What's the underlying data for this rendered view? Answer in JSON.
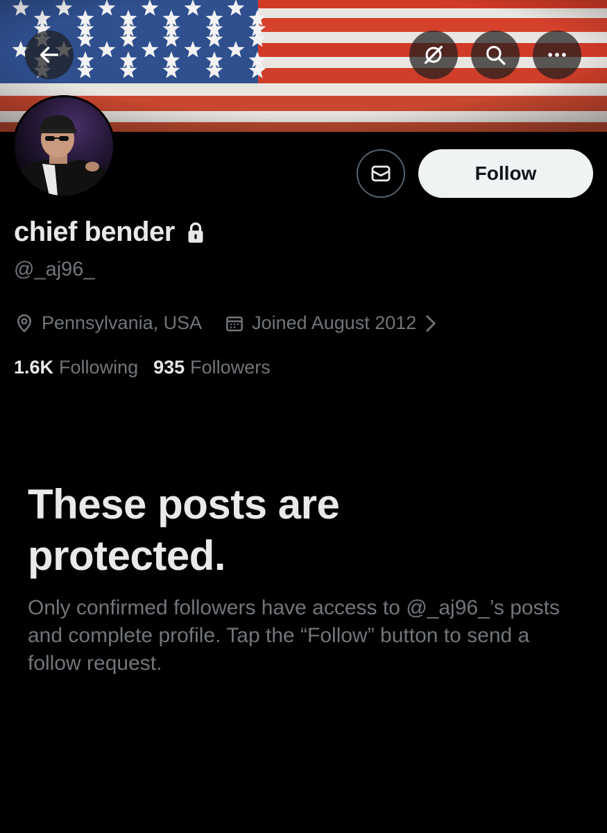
{
  "header": {
    "back_icon": "arrow-left-icon",
    "grok_icon": "grok-icon",
    "search_icon": "search-icon",
    "more_icon": "more-horizontal-icon"
  },
  "banner": {
    "description_colors": {
      "flag_red": "#d23a28",
      "flag_white": "#e9e6e2",
      "flag_blue": "#2f4f8f"
    }
  },
  "profile": {
    "display_name": "chief bender",
    "handle": "@_aj96_",
    "location": "Pennsylvania, USA",
    "joined": "Joined August 2012",
    "following_count": "1.6K",
    "following_label": "Following",
    "followers_count": "935",
    "followers_label": "Followers"
  },
  "actions": {
    "follow_label": "Follow",
    "message_icon": "mail-icon"
  },
  "protected": {
    "title": "These posts are protected.",
    "body": "Only confirmed followers have access to @_aj96_’s posts and complete profile. Tap the “Follow” button to send a follow request."
  },
  "colors": {
    "background": "#000000",
    "primary_text": "#e7e9ea",
    "secondary_text": "#71767b",
    "follow_button_bg": "#eff3f4"
  }
}
